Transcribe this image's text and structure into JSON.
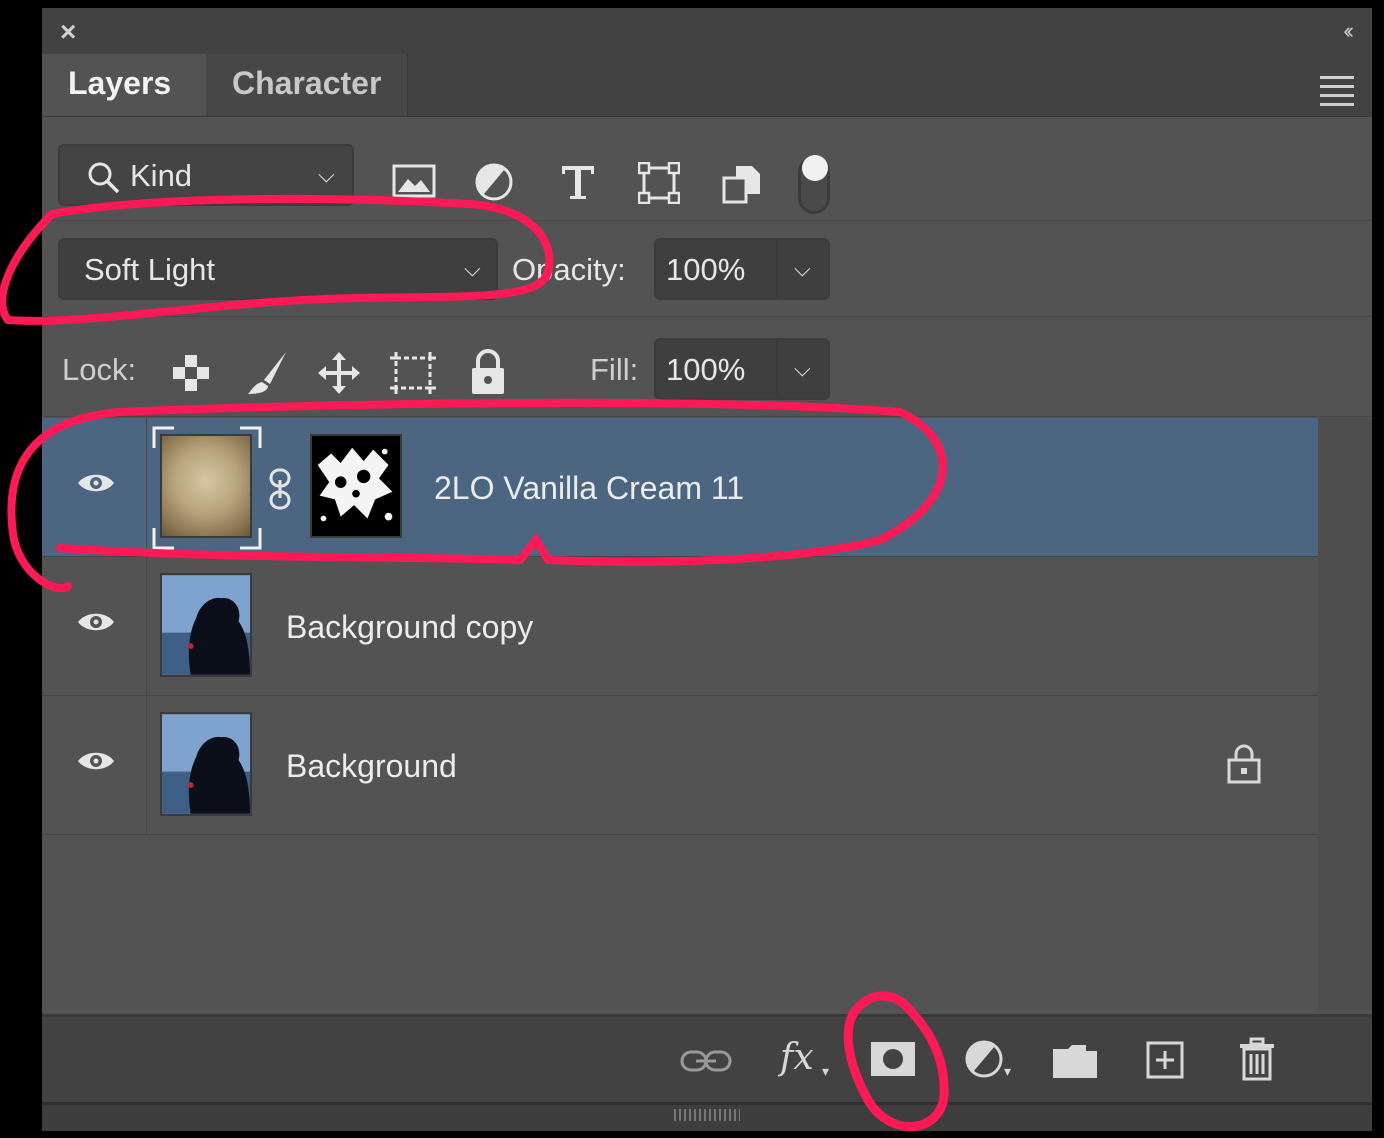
{
  "panel": {
    "close_glyph": "×",
    "collapse_glyph": "‹‹",
    "tabs": [
      {
        "label": "Layers",
        "active": true
      },
      {
        "label": "Character",
        "active": false
      }
    ]
  },
  "filter": {
    "kind_label": "Kind",
    "filter_icons": [
      "image-filter-icon",
      "adjustment-filter-icon",
      "type-filter-icon",
      "shape-filter-icon",
      "smart-object-filter-icon"
    ]
  },
  "blend": {
    "mode": "Soft Light",
    "opacity_label": "Opacity:",
    "opacity_value": "100%"
  },
  "lock": {
    "label": "Lock:",
    "fill_label": "Fill:",
    "fill_value": "100%"
  },
  "layers": [
    {
      "name": "2LO Vanilla Cream 11",
      "visible": true,
      "selected": true,
      "has_mask": true
    },
    {
      "name": "Background copy",
      "visible": true,
      "selected": false
    },
    {
      "name": "Background",
      "visible": true,
      "selected": false,
      "locked": true
    }
  ],
  "bottom_actions": [
    "link-layers",
    "layer-style-fx",
    "add-mask",
    "new-adjustment",
    "new-group",
    "new-layer",
    "delete-layer"
  ],
  "colors": {
    "panel_bg": "#535353",
    "selected_row": "#4c6682",
    "annotation": "#ff1a55"
  }
}
